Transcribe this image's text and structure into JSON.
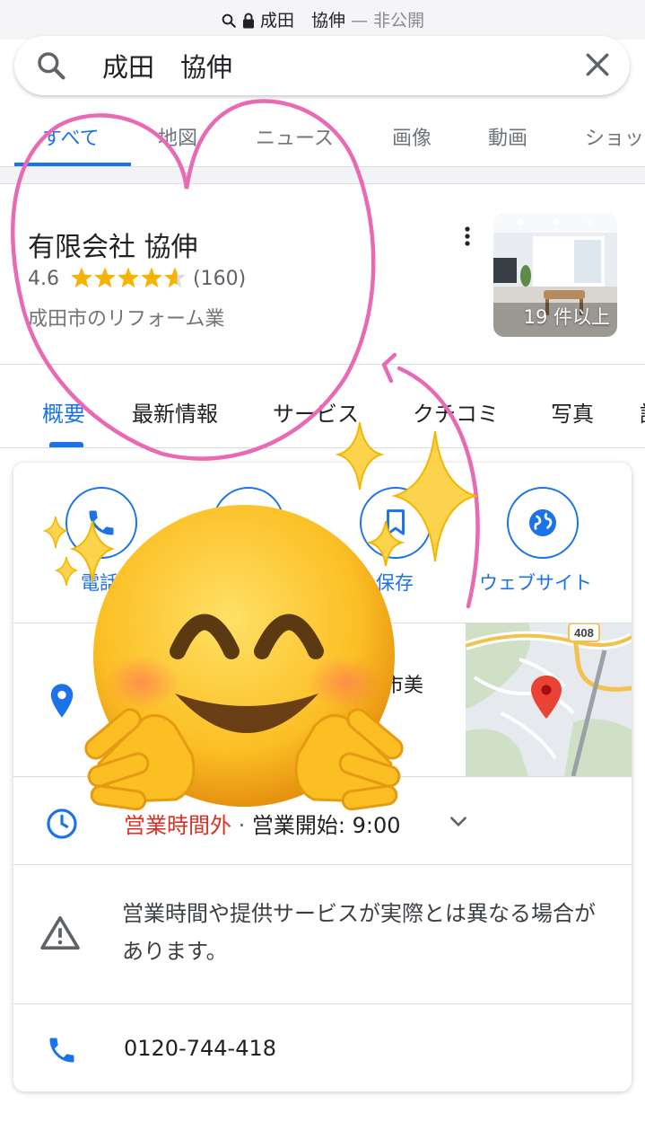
{
  "status_bar": {
    "query": "成田　協伸",
    "separator": "—",
    "privacy": "非公開"
  },
  "search": {
    "query": "成田　協伸"
  },
  "search_tabs": [
    "すべて",
    "地図",
    "ニュース",
    "画像",
    "動画",
    "ショッ"
  ],
  "place": {
    "name": "有限会社 協伸",
    "rating": "4.6",
    "stars": 4.6,
    "review_count": "(160)",
    "category": "成田市のリフォーム業",
    "photo_count_label": "19 件以上"
  },
  "place_tabs": [
    "概要",
    "最新情報",
    "サービス",
    "クチコミ",
    "写真",
    "詳"
  ],
  "actions": {
    "call": "電話",
    "save": "保存",
    "website": "ウェブサイト"
  },
  "address_partial": "市美",
  "map": {
    "route_badge": "408"
  },
  "hours": {
    "status": "営業時間外",
    "dot": "·",
    "opens": "営業開始: 9:00"
  },
  "notice": "営業時間や提供サービスが実際とは異なる場合があります。",
  "phone": "0120-744-418",
  "colors": {
    "accent": "#1a73e8",
    "closed": "#d93025",
    "star": "#f6b300",
    "annotation": "#e86ab5"
  }
}
